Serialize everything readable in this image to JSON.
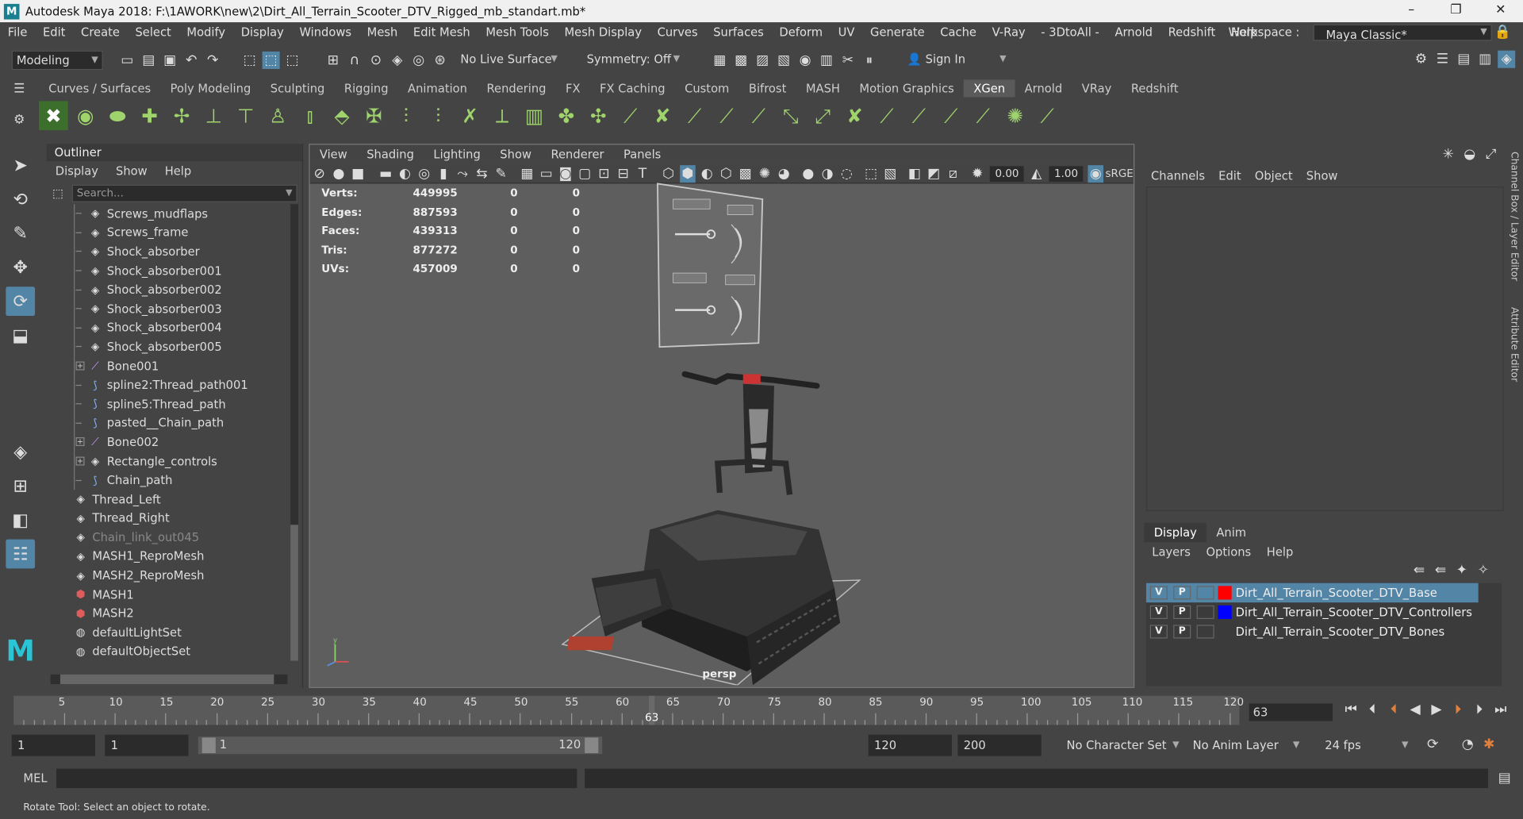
{
  "title": "Autodesk Maya 2018: F:\\1AWORK\\new\\2\\Dirt_All_Terrain_Scooter_DTV_Rigged_mb_standart.mb*",
  "menu": [
    "File",
    "Edit",
    "Create",
    "Select",
    "Modify",
    "Display",
    "Windows",
    "Mesh",
    "Edit Mesh",
    "Mesh Tools",
    "Mesh Display",
    "Curves",
    "Surfaces",
    "Deform",
    "UV",
    "Generate",
    "Cache",
    "V-Ray",
    "- 3DtoAll -",
    "Arnold",
    "Redshift",
    "Help"
  ],
  "workspace_label": "Workspace :",
  "workspace_value": "Maya Classic*",
  "mode": "Modeling",
  "live_surface": "No Live Surface",
  "symmetry": "Symmetry: Off",
  "sign_in": "Sign In",
  "shelf_tabs": [
    "Curves / Surfaces",
    "Poly Modeling",
    "Sculpting",
    "Rigging",
    "Animation",
    "Rendering",
    "FX",
    "FX Caching",
    "Custom",
    "Bifrost",
    "MASH",
    "Motion Graphics",
    "XGen",
    "Arnold",
    "VRay",
    "Redshift"
  ],
  "shelf_active": "XGen",
  "outliner": {
    "title": "Outliner",
    "menu": [
      "Display",
      "Show",
      "Help"
    ],
    "search_placeholder": "Search...",
    "items": [
      {
        "label": "Screws_mudflaps",
        "indent": 2,
        "icon": "mesh"
      },
      {
        "label": "Screws_frame",
        "indent": 2,
        "icon": "mesh"
      },
      {
        "label": "Shock_absorber",
        "indent": 2,
        "icon": "mesh"
      },
      {
        "label": "Shock_absorber001",
        "indent": 2,
        "icon": "mesh"
      },
      {
        "label": "Shock_absorber002",
        "indent": 2,
        "icon": "mesh"
      },
      {
        "label": "Shock_absorber003",
        "indent": 2,
        "icon": "mesh"
      },
      {
        "label": "Shock_absorber004",
        "indent": 2,
        "icon": "mesh"
      },
      {
        "label": "Shock_absorber005",
        "indent": 2,
        "icon": "mesh"
      },
      {
        "label": "Bone001",
        "indent": 2,
        "icon": "bone",
        "expand": true
      },
      {
        "label": "spline2:Thread_path001",
        "indent": 2,
        "icon": "curve"
      },
      {
        "label": "spline5:Thread_path",
        "indent": 2,
        "icon": "curve"
      },
      {
        "label": "pasted__Chain_path",
        "indent": 2,
        "icon": "curve"
      },
      {
        "label": "Bone002",
        "indent": 2,
        "icon": "bone",
        "expand": true
      },
      {
        "label": "Rectangle_controls",
        "indent": 2,
        "icon": "mesh",
        "expand": true
      },
      {
        "label": "Chain_path",
        "indent": 2,
        "icon": "curve"
      },
      {
        "label": "Thread_Left",
        "indent": 1,
        "icon": "mesh"
      },
      {
        "label": "Thread_Right",
        "indent": 1,
        "icon": "mesh"
      },
      {
        "label": "Chain_link_out045",
        "indent": 1,
        "icon": "mesh",
        "dim": true
      },
      {
        "label": "MASH1_ReproMesh",
        "indent": 1,
        "icon": "mesh"
      },
      {
        "label": "MASH2_ReproMesh",
        "indent": 1,
        "icon": "mesh"
      },
      {
        "label": "MASH1",
        "indent": 1,
        "icon": "mash"
      },
      {
        "label": "MASH2",
        "indent": 1,
        "icon": "mash"
      },
      {
        "label": "defaultLightSet",
        "indent": 1,
        "icon": "set"
      },
      {
        "label": "defaultObjectSet",
        "indent": 1,
        "icon": "set"
      }
    ]
  },
  "viewport": {
    "menu": [
      "View",
      "Shading",
      "Lighting",
      "Show",
      "Renderer",
      "Panels"
    ],
    "exposure": "0.00",
    "gamma": "1.00",
    "color_space": "sRGE",
    "camera": "persp",
    "hud": [
      [
        "Verts:",
        "449995",
        "0",
        "0"
      ],
      [
        "Edges:",
        "887593",
        "0",
        "0"
      ],
      [
        "Faces:",
        "439313",
        "0",
        "0"
      ],
      [
        "Tris:",
        "877272",
        "0",
        "0"
      ],
      [
        "UVs:",
        "457009",
        "0",
        "0"
      ]
    ]
  },
  "channel_box": {
    "menu": [
      "Channels",
      "Edit",
      "Object",
      "Show"
    ]
  },
  "layer_editor": {
    "tabs": [
      "Display",
      "Anim"
    ],
    "menu": [
      "Layers",
      "Options",
      "Help"
    ],
    "layers": [
      {
        "v": "V",
        "p": "P",
        "color": "#ff0000",
        "name": "Dirt_All_Terrain_Scooter_DTV_Base",
        "selected": true
      },
      {
        "v": "V",
        "p": "P",
        "color": "#0000ff",
        "name": "Dirt_All_Terrain_Scooter_DTV_Controllers",
        "selected": false
      },
      {
        "v": "V",
        "p": "P",
        "color": "#3b3b3b",
        "name": "Dirt_All_Terrain_Scooter_DTV_Bones",
        "selected": false
      }
    ]
  },
  "side_tabs": [
    "Channel Box / Layer Editor",
    "Attribute Editor"
  ],
  "timeline": {
    "ticks": [
      "5",
      "10",
      "15",
      "20",
      "25",
      "30",
      "35",
      "40",
      "45",
      "50",
      "55",
      "60",
      "65",
      "70",
      "75",
      "80",
      "85",
      "90",
      "95",
      "100",
      "105",
      "110",
      "115",
      "120"
    ],
    "current": "63",
    "frame_field": "63"
  },
  "range": {
    "start": "1",
    "start2": "1",
    "slider_start": "1",
    "slider_end": "120",
    "end": "120",
    "end2": "200",
    "character_set": "No Character Set",
    "anim_layer": "No Anim Layer",
    "fps": "24 fps"
  },
  "mel_label": "MEL",
  "help_line": "Rotate Tool: Select an object to rotate."
}
